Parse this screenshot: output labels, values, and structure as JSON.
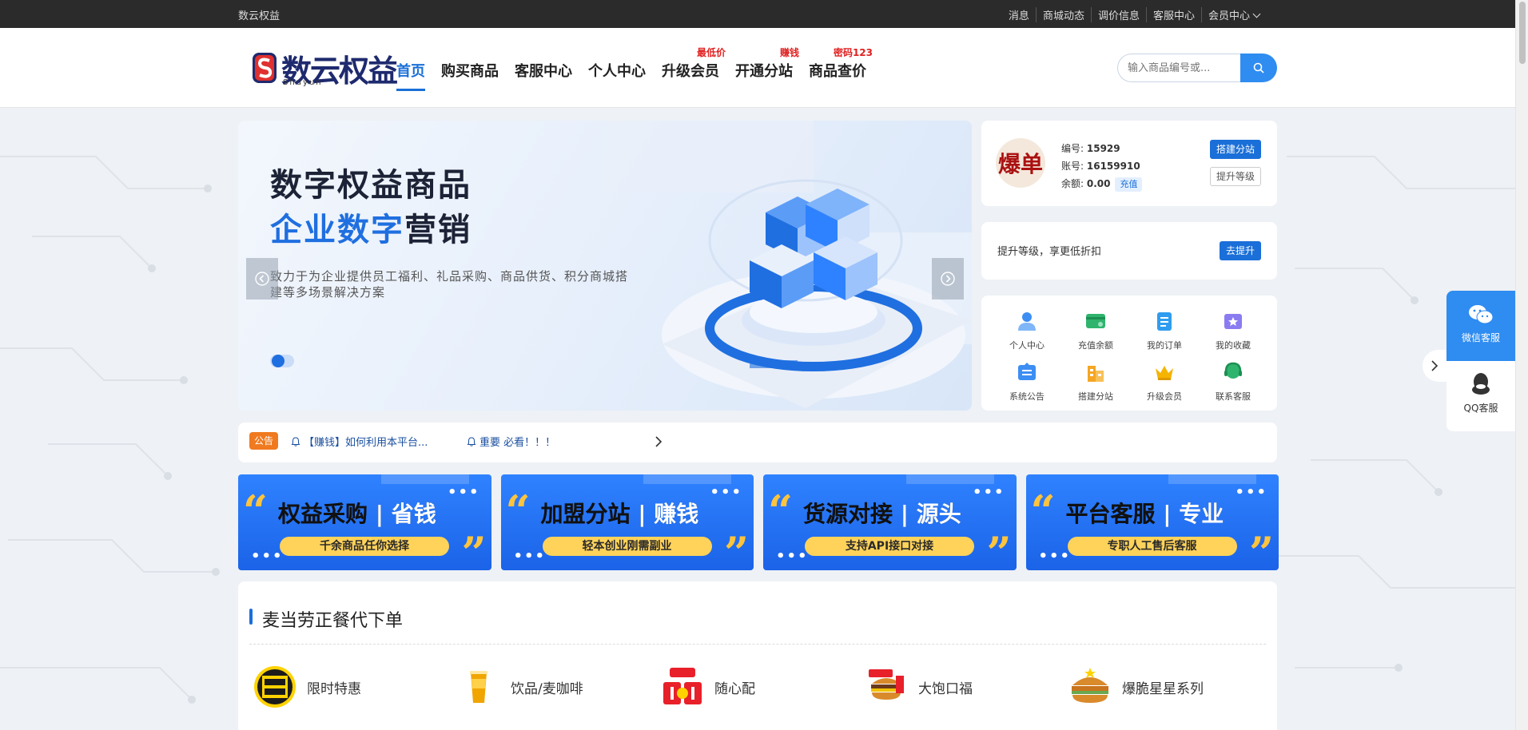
{
  "topbar": {
    "site_name": "数云权益",
    "links": [
      "消息",
      "商城动态",
      "调价信息",
      "客服中心",
      "会员中心"
    ]
  },
  "header": {
    "logo_text": "数云权益",
    "logo_sub": "Shuyun",
    "nav": [
      {
        "label": "首页",
        "active": true,
        "tag": ""
      },
      {
        "label": "购买商品",
        "active": false,
        "tag": ""
      },
      {
        "label": "客服中心",
        "active": false,
        "tag": ""
      },
      {
        "label": "个人中心",
        "active": false,
        "tag": ""
      },
      {
        "label": "升级会员",
        "active": false,
        "tag": "最低价"
      },
      {
        "label": "开通分站",
        "active": false,
        "tag": "赚钱"
      },
      {
        "label": "商品查价",
        "active": false,
        "tag": "密码123"
      }
    ],
    "search_placeholder": "输入商品编号或..."
  },
  "banner": {
    "line1": "数字权益商品",
    "line2_blue": "企业数字",
    "line2_rest": "营销",
    "desc": "致力于为企业提供员工福利、礼品采购、商品供货、积分商城搭建等多场景解决方案"
  },
  "user": {
    "avatar_text": "爆单",
    "id_label": "编号:",
    "id_value": "15929",
    "account_label": "账号:",
    "account_value": "16159910",
    "balance_label": "余额:",
    "balance_value": "0.00",
    "charge_label": "充值",
    "build_station": "搭建分站",
    "upgrade_level": "提升等级"
  },
  "upgrade": {
    "text": "提升等级，享更低折扣",
    "button": "去提升"
  },
  "quick_menu": [
    {
      "label": "个人中心",
      "icon": "user-icon"
    },
    {
      "label": "充值余额",
      "icon": "wallet-icon"
    },
    {
      "label": "我的订单",
      "icon": "order-icon"
    },
    {
      "label": "我的收藏",
      "icon": "star-folder-icon"
    },
    {
      "label": "系统公告",
      "icon": "announcement-icon"
    },
    {
      "label": "搭建分站",
      "icon": "building-icon"
    },
    {
      "label": "升级会员",
      "icon": "crown-icon"
    },
    {
      "label": "联系客服",
      "icon": "headset-icon"
    }
  ],
  "notice": {
    "badge": "公告",
    "items": [
      "【赚钱】如何利用本平台...",
      "重要 必看！！！"
    ]
  },
  "promos": [
    {
      "title_a": "权益采购",
      "title_b": "省钱",
      "sub": "千余商品任你选择"
    },
    {
      "title_a": "加盟分站",
      "title_b": "赚钱",
      "sub": "轻本创业刚需副业"
    },
    {
      "title_a": "货源对接",
      "title_b": "源头",
      "sub": "支持API接口对接"
    },
    {
      "title_a": "平台客服",
      "title_b": "专业",
      "sub": "专职人工售后客服"
    }
  ],
  "section": {
    "title": "麦当劳正餐代下单",
    "categories": [
      {
        "label": "限时特惠",
        "icon": "limited-offer-icon"
      },
      {
        "label": "饮品/麦咖啡",
        "icon": "drink-icon"
      },
      {
        "label": "随心配",
        "icon": "combo-icon"
      },
      {
        "label": "大饱口福",
        "icon": "burger-meal-icon"
      },
      {
        "label": "爆脆星星系列",
        "icon": "crispy-burger-icon"
      }
    ]
  },
  "float": {
    "wechat": "微信客服",
    "qq": "QQ客服"
  },
  "colors": {
    "accent": "#1a6fd8",
    "notice_badge": "#f07a1f",
    "promo_blue": "#2f82ff",
    "promo_yellow": "#ffd35a"
  }
}
